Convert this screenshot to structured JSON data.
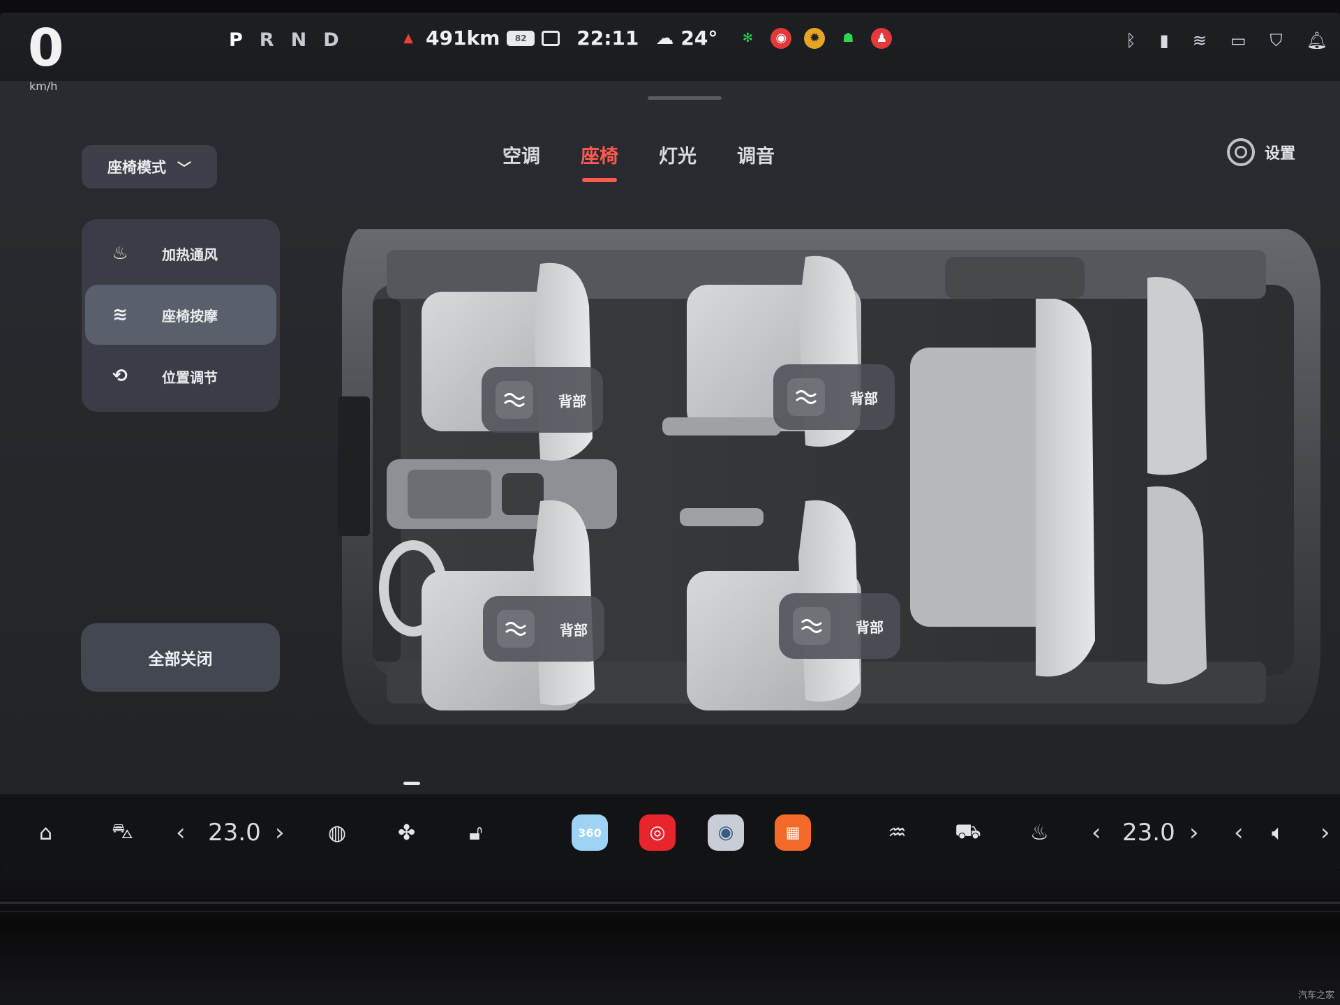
{
  "status_bar": {
    "speed": "0",
    "speed_unit": "km/h",
    "gears": [
      "P",
      "R",
      "N",
      "D"
    ],
    "range": "491km",
    "battery_level": "82",
    "time": "22:11",
    "temperature": "24°",
    "indicator_colors": [
      "#2fd84a",
      "#e23a3a",
      "#e6a623",
      "#2fd84a",
      "#e23a3a"
    ],
    "right_icons": [
      "bluetooth-icon",
      "signal-icon",
      "wifi-icon",
      "dashcam-icon",
      "shield-icon",
      "bell-icon"
    ]
  },
  "tabs": [
    {
      "label": "空调",
      "active": false
    },
    {
      "label": "座椅",
      "active": true
    },
    {
      "label": "灯光",
      "active": false
    },
    {
      "label": "调音",
      "active": false
    }
  ],
  "settings_label": "设置",
  "mode_select": {
    "label": "座椅模式"
  },
  "menu": [
    {
      "label": "加热通风",
      "icon": "seat-heat-icon",
      "active": false
    },
    {
      "label": "座椅按摩",
      "icon": "seat-massage-icon",
      "active": true
    },
    {
      "label": "位置调节",
      "icon": "seat-position-icon",
      "active": false
    }
  ],
  "all_off_label": "全部关闭",
  "seats": [
    {
      "id": "driver",
      "label": "背部"
    },
    {
      "id": "front-passenger",
      "label": "背部"
    },
    {
      "id": "second-row-left",
      "label": "背部"
    },
    {
      "id": "second-row-right",
      "label": "背部"
    }
  ],
  "dock": {
    "left_temp": "23.0",
    "right_temp": "23.0",
    "apps": [
      {
        "name": "360-camera-app",
        "label": "360",
        "color": "#9fd3f5"
      },
      {
        "name": "music-app",
        "color": "#e8242c"
      },
      {
        "name": "camera-app",
        "color": "#c9ced6"
      },
      {
        "name": "apps-grid",
        "color": "#f46a2a"
      }
    ]
  },
  "watermark": "汽车之家"
}
